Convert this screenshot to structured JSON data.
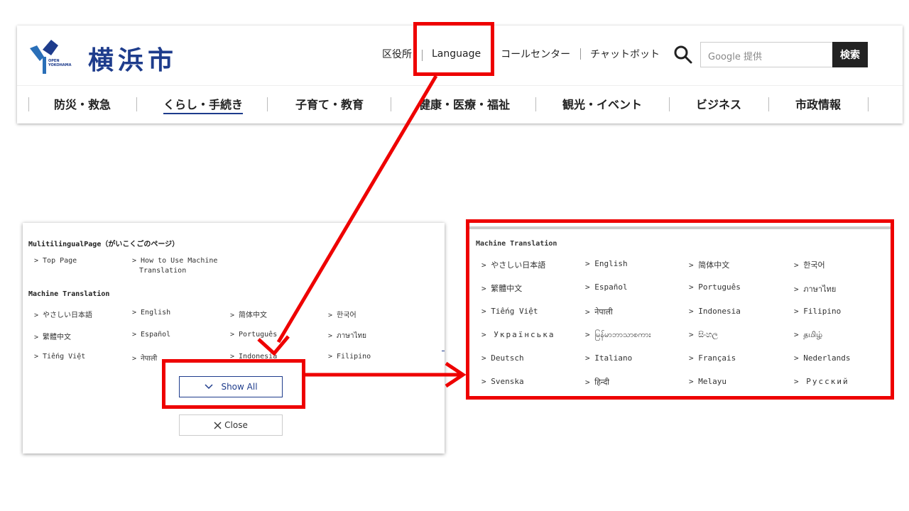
{
  "header": {
    "logo_small": "OPEN\nYOKOHAMA",
    "city_name": "横浜市",
    "utility_links": [
      "区役所",
      "Language",
      "コールセンター",
      "チャットボット"
    ],
    "search_placeholder": "Google 提供",
    "search_button": "検索",
    "nav": [
      "防災・救急",
      "くらし・手続き",
      "子育て・教育",
      "健康・医療・福祉",
      "観光・イベント",
      "ビジネス",
      "市政情報"
    ],
    "nav_active_index": 1
  },
  "popup": {
    "section1_title": "MulitilingualPage（がいこくごのページ）",
    "section1_items": [
      "> Top Page",
      "> How to Use Machine",
      "Translation"
    ],
    "section2_title": "Machine Translation",
    "items": [
      "> やさしい日本語",
      "> English",
      "> 简体中文",
      "> 한국어",
      "> 繁體中文",
      "> Español",
      "> Português",
      "> ภาษาไทย",
      "> Tiếng Việt",
      "> नेपाली",
      "> Indonesia",
      "> Filipino"
    ],
    "show_all": "Show All",
    "close": "Close"
  },
  "expanded": {
    "title": "Machine Translation",
    "items": [
      "> やさしい日本語",
      "> English",
      "> 简体中文",
      "> 한국어",
      "> 繁體中文",
      "> Español",
      "> Português",
      "> ภาษาไทย",
      "> Tiếng Việt",
      "> नेपाली",
      "> Indonesia",
      "> Filipino",
      "> Українська",
      "> မြန်မာဘာသာစကား",
      "> සිංහල",
      "> தமிழ்",
      "> Deutsch",
      "> Italiano",
      "> Français",
      "> Nederlands",
      "> Svenska",
      "> हिन्दी",
      "> Melayu",
      "> Русский"
    ]
  },
  "colors": {
    "annotation_red": "#ee0000",
    "brand_navy": "#1e3c8c"
  },
  "icons": [
    "search-icon",
    "chevron-down-icon",
    "close-icon",
    "yokohama-logo-icon"
  ]
}
